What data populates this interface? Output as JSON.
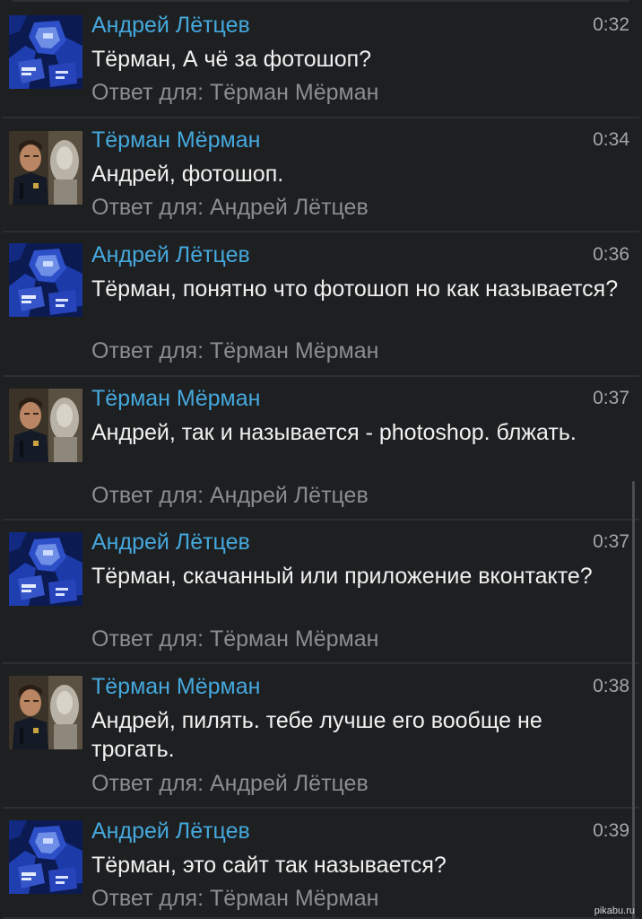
{
  "comments": [
    {
      "author": "Андрей Лётцев",
      "time": "0:32",
      "text": "Тёрман, А чё за фотошоп?",
      "reply": "Ответ для: Тёрман Мёрман",
      "avatar": "blue-robot-avatar"
    },
    {
      "author": "Тёрман Мёрман",
      "time": "0:34",
      "text": "Андрей, фотошоп.",
      "reply": "Ответ для: Андрей Лётцев",
      "avatar": "police-officer-avatar"
    },
    {
      "author": "Андрей Лётцев",
      "time": "0:36",
      "text": "Тёрман, понятно что фотошоп но как называется?",
      "reply": "Ответ для: Тёрман Мёрман",
      "avatar": "blue-robot-avatar"
    },
    {
      "author": "Тёрман Мёрман",
      "time": "0:37",
      "text": "Андрей, так и называется - photoshop. блжать.",
      "reply": "Ответ для: Андрей Лётцев",
      "avatar": "police-officer-avatar"
    },
    {
      "author": "Андрей Лётцев",
      "time": "0:37",
      "text": "Тёрман, скачанный или приложение вконтакте?",
      "reply": "Ответ для: Тёрман Мёрман",
      "avatar": "blue-robot-avatar"
    },
    {
      "author": "Тёрман Мёрман",
      "time": "0:38",
      "text": "Андрей, пилять. тебе лучше его вообще не трогать.",
      "reply": "Ответ для: Андрей Лётцев",
      "avatar": "police-officer-avatar"
    },
    {
      "author": "Андрей Лётцев",
      "time": "0:39",
      "text": "Тёрман, это сайт так называется?",
      "reply": "Ответ для: Тёрман Мёрман",
      "avatar": "blue-robot-avatar"
    }
  ],
  "watermark": "pikabu.ru",
  "colors": {
    "background": "#1d1f21",
    "author": "#45a8dc",
    "text": "#f1f1f1",
    "reply": "#8b8d90",
    "time": "#a4a6a8"
  }
}
